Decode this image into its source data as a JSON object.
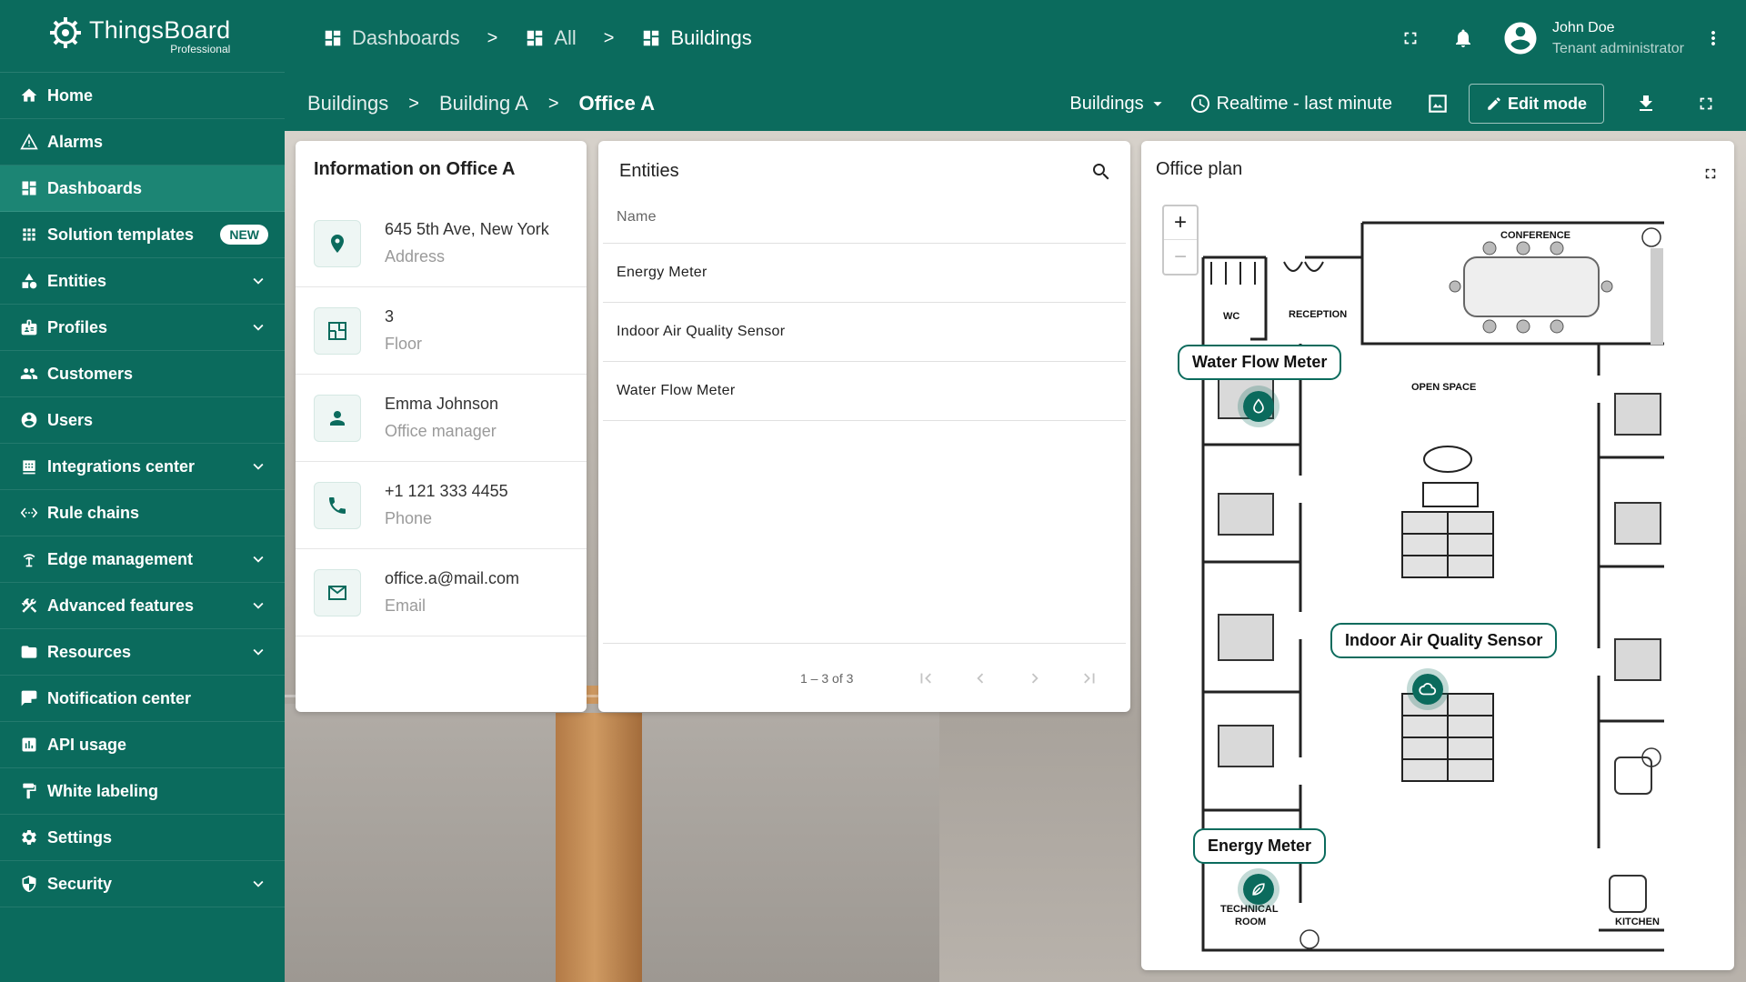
{
  "app": {
    "brand_name": "ThingsBoard",
    "brand_sub": "Professional"
  },
  "sidebar": {
    "items": [
      {
        "label": "Home",
        "icon": "home-icon"
      },
      {
        "label": "Alarms",
        "icon": "warning-icon"
      },
      {
        "label": "Dashboards",
        "icon": "dashboard-icon",
        "active": true
      },
      {
        "label": "Solution templates",
        "icon": "apps-icon",
        "badge": "NEW"
      },
      {
        "label": "Entities",
        "icon": "category-icon",
        "expandable": true
      },
      {
        "label": "Profiles",
        "icon": "badge-icon",
        "expandable": true
      },
      {
        "label": "Customers",
        "icon": "people-icon"
      },
      {
        "label": "Users",
        "icon": "account-circle-icon"
      },
      {
        "label": "Integrations center",
        "icon": "integration-icon",
        "expandable": true
      },
      {
        "label": "Rule chains",
        "icon": "settings-ethernet-icon"
      },
      {
        "label": "Edge management",
        "icon": "router-icon",
        "expandable": true
      },
      {
        "label": "Advanced features",
        "icon": "construction-icon",
        "expandable": true
      },
      {
        "label": "Resources",
        "icon": "folder-icon",
        "expandable": true
      },
      {
        "label": "Notification center",
        "icon": "mark-chat-icon"
      },
      {
        "label": "API usage",
        "icon": "insert-chart-icon"
      },
      {
        "label": "White labeling",
        "icon": "format-paint-icon"
      },
      {
        "label": "Settings",
        "icon": "settings-icon"
      },
      {
        "label": "Security",
        "icon": "security-icon",
        "expandable": true
      }
    ]
  },
  "topbar": {
    "breadcrumbs": [
      "Dashboards",
      "All",
      "Buildings"
    ],
    "separator": ">",
    "user": {
      "name": "John Doe",
      "role": "Tenant administrator"
    }
  },
  "dashbar": {
    "breadcrumbs": [
      "Buildings",
      "Building A",
      "Office A"
    ],
    "separator": ">",
    "state_select": "Buildings",
    "timewindow": "Realtime - last minute",
    "edit_mode": "Edit mode"
  },
  "info_card": {
    "title": "Information on Office A",
    "rows": [
      {
        "value": "645 5th Ave, New York",
        "label": "Address",
        "icon": "location-pin-icon"
      },
      {
        "value": "3",
        "label": "Floor",
        "icon": "floor-plan-icon"
      },
      {
        "value": "Emma Johnson",
        "label": "Office manager",
        "icon": "person-icon"
      },
      {
        "value": "+1 121 333 4455",
        "label": "Phone",
        "icon": "phone-icon"
      },
      {
        "value": "office.a@mail.com",
        "label": "Email",
        "icon": "mail-icon"
      }
    ]
  },
  "entities_card": {
    "title": "Entities",
    "column": "Name",
    "rows": [
      "Energy Meter",
      "Indoor Air Quality Sensor",
      "Water Flow Meter"
    ],
    "pagination": "1 – 3 of 3"
  },
  "plan_card": {
    "title": "Office plan",
    "zoom_in": "+",
    "zoom_out": "−",
    "rooms": [
      "CONFERENCE",
      "RECEPTION",
      "WC",
      "OPEN SPACE",
      "KITCHEN",
      "TECHNICAL ROOM"
    ],
    "markers": [
      "Water Flow Meter",
      "Indoor Air Quality Sensor",
      "Energy Meter"
    ]
  },
  "colors": {
    "primary": "#0b6b5d",
    "active_nav": "#1c8574",
    "accent": "#ffffff"
  }
}
